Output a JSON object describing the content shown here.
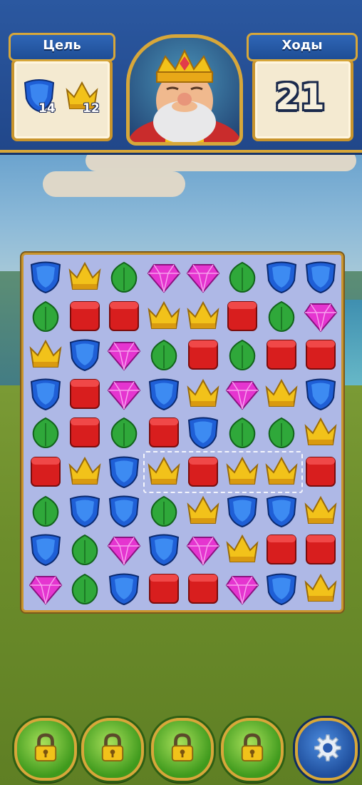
{
  "hud": {
    "goal_label": "Цель",
    "moves_label": "Ходы",
    "moves_value": "21",
    "goals": [
      {
        "icon": "blue-shield-icon",
        "count": "14"
      },
      {
        "icon": "yellow-crown-icon",
        "count": "12"
      }
    ]
  },
  "board": {
    "rows": [
      [
        "shield",
        "crown",
        "leaf",
        "gem",
        "gem",
        "leaf",
        "shield",
        "shield"
      ],
      [
        "leaf",
        "box",
        "box",
        "crown",
        "crown",
        "box",
        "leaf",
        "gem"
      ],
      [
        "crown",
        "shield",
        "gem",
        "leaf",
        "box",
        "leaf",
        "box",
        "box"
      ],
      [
        "shield",
        "box",
        "gem",
        "shield",
        "crown",
        "gem",
        "crown",
        "shield"
      ],
      [
        "leaf",
        "box",
        "leaf",
        "box",
        "shield",
        "leaf",
        "leaf",
        "crown"
      ],
      [
        "box",
        "crown",
        "shield",
        "crown",
        "box",
        "crown",
        "crown",
        "box"
      ],
      [
        "leaf",
        "shield",
        "shield",
        "leaf",
        "crown",
        "shield",
        "shield",
        "crown"
      ],
      [
        "shield",
        "leaf",
        "gem",
        "shield",
        "gem",
        "crown",
        "box",
        "box"
      ],
      [
        "gem",
        "leaf",
        "shield",
        "box",
        "box",
        "gem",
        "shield",
        "crown"
      ]
    ],
    "hint_row": 5,
    "hint_cols": [
      3,
      6
    ]
  },
  "boosters": [
    {
      "icon": "lock-icon"
    },
    {
      "icon": "lock-icon"
    },
    {
      "icon": "lock-icon"
    },
    {
      "icon": "lock-icon"
    },
    {
      "icon": "gear-icon"
    }
  ],
  "colors": {
    "shield": "#1f5fd6",
    "crown": "#f2c21a",
    "leaf": "#2fa83a",
    "gem": "#e535d0",
    "box": "#d81e1e"
  }
}
